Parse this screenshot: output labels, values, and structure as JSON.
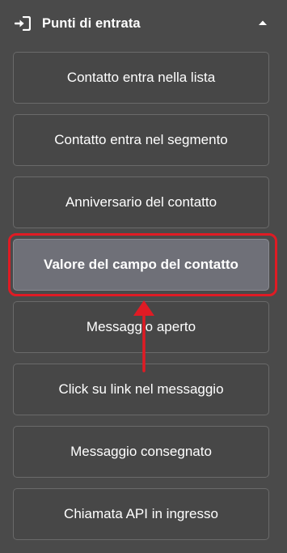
{
  "header": {
    "title": "Punti di entrata",
    "icon": "sign-in-icon",
    "collapse_icon": "caret-up-icon"
  },
  "items": [
    {
      "label": "Contatto entra nella lista"
    },
    {
      "label": "Contatto entra nel segmento"
    },
    {
      "label": "Anniversario del contatto"
    },
    {
      "label": "Valore del campo del contatto",
      "selected": true
    },
    {
      "label": "Messaggio aperto"
    },
    {
      "label": "Click su link nel messaggio"
    },
    {
      "label": "Messaggio consegnato"
    },
    {
      "label": "Chiamata API in ingresso"
    }
  ],
  "colors": {
    "panel_bg": "#4a4a4a",
    "item_bg": "#474747",
    "selected_bg": "#6f7078",
    "annotation": "#e01b24"
  }
}
